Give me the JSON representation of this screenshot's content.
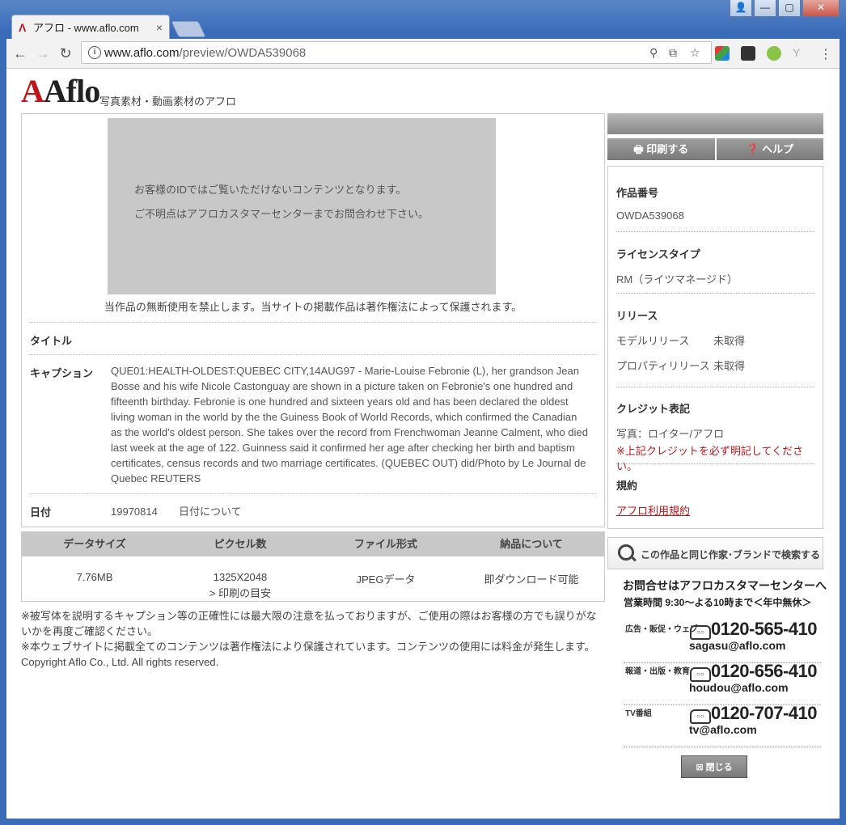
{
  "browser": {
    "tab_title": "アフロ - www.aflo.com",
    "tab_close": "×",
    "url_host": "www.aflo.com",
    "url_path": "/preview/OWDA539068",
    "window_controls": {
      "minimize": "—",
      "maximize": "▢",
      "close": "✕"
    }
  },
  "site": {
    "logo": "Aflo",
    "tagline": "写真素材・動画素材のアフロ"
  },
  "preview": {
    "message1": "お客様のIDではご覧いただけないコンテンツとなります。",
    "message2": "ご不明点はアフロカスタマーセンターまでお問合わせ下さい。",
    "copyright_note": "当作品の無断使用を禁止します。当サイトの掲載作品は著作権法によって保護されます。"
  },
  "details": {
    "title_label": "タイトル",
    "title_value": "",
    "caption_label": "キャプション",
    "caption_value": "QUE01:HEALTH-OLDEST:QUEBEC CITY,14AUG97 - Marie-Louise Febronie (L), her grandson Jean Bosse and his wife Nicole Castonguay are shown in a picture taken on Febronie's one hundred and fifteenth birthday. Febronie is one hundred and sixteen years old and has been declared the oldest living woman in the world by the the Guiness Book of World Records, which confirmed the Canadian as the world's oldest person. She takes over the record from Frenchwoman Jeanne Calment, who died last week at the age of 122. Guinness said it confirmed her age after checking her birth and baptism certificates, census records and two marriage certificates. (QUEBEC OUT) did/Photo by Le Journal de Quebec REUTERS",
    "date_label": "日付",
    "date_value": "19970814",
    "date_link": "日付について"
  },
  "specs": {
    "headers": [
      "データサイズ",
      "ピクセル数",
      "ファイル形式",
      "納品について"
    ],
    "values": [
      "7.76MB",
      "1325X2048",
      "JPEGデータ",
      "即ダウンロード可能"
    ],
    "print_guide": "> 印刷の目安"
  },
  "notes": {
    "line1": "※被写体を説明するキャプション等の正確性には最大限の注意を払っておりますが、ご使用の際はお客様の方でも誤りがないかを再度ご確認ください。",
    "line2": "※本ウェブサイトに掲載全てのコンテンツは著作権法により保護されています。コンテンツの使用には料金が発生します。",
    "copyright": "Copyright Aflo Co., Ltd. All rights reserved."
  },
  "sidebar": {
    "print_button": "印刷する",
    "help_button": "ヘルプ",
    "work_no_label": "作品番号",
    "work_no_value": "OWDA539068",
    "license_label": "ライセンスタイプ",
    "license_value": "RM（ライツマネージド）",
    "release_label": "リリース",
    "model_release_label": "モデルリリース",
    "model_release_value": "未取得",
    "property_release_label": "プロパティリリース",
    "property_release_value": "未取得",
    "credit_label": "クレジット表記",
    "credit_value": "写真：ロイター/アフロ",
    "credit_warning": "※上記クレジットを必ず明記してください。",
    "terms_label": "規約",
    "terms_link": "アフロ利用規約",
    "search_button": "この作品と同じ作家･ブランドで検索する"
  },
  "contact": {
    "title": "お問合せはアフロカスタマーセンターへ",
    "hours": "営業時間 9:30～よる10時まで＜年中無休＞",
    "rows": [
      {
        "type": "広告・販促・ウェブ",
        "tel": "0120-565-410",
        "mail": "sagasu@aflo.com"
      },
      {
        "type": "報道・出版・教育",
        "tel": "0120-656-410",
        "mail": "houdou@aflo.com"
      },
      {
        "type": "TV番組",
        "tel": "0120-707-410",
        "mail": "tv@aflo.com"
      }
    ],
    "close_button": "閉じる"
  },
  "colors": {
    "brand_red": "#c0141b",
    "chrome_blue": "#3a6bb8"
  }
}
